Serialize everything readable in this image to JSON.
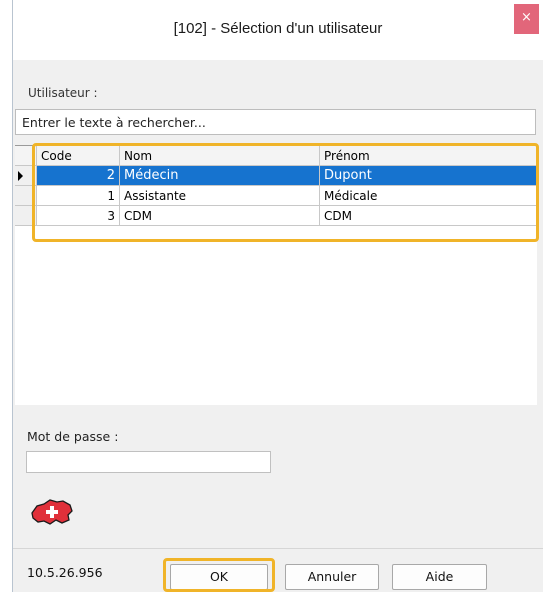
{
  "window": {
    "title": "[102] - Sélection d'un utilisateur",
    "close_label": "×"
  },
  "user_section": {
    "label": "Utilisateur :",
    "search_text": "Entrer le texte à rechercher..."
  },
  "grid": {
    "columns": [
      "Code",
      "Nom",
      "Prénom"
    ],
    "rows": [
      {
        "code": "2",
        "nom": "Médecin",
        "prenom": "Dupont",
        "selected": true
      },
      {
        "code": "1",
        "nom": "Assistante",
        "prenom": "Médicale",
        "selected": false
      },
      {
        "code": "3",
        "nom": "CDM",
        "prenom": "CDM",
        "selected": false
      }
    ]
  },
  "password": {
    "label": "Mot de passe :",
    "value": ""
  },
  "footer": {
    "version": "10.5.26.956",
    "ok_label": "OK",
    "cancel_label": "Annuler",
    "help_label": "Aide"
  },
  "colors": {
    "selection": "#1673cf",
    "highlight": "#f0b429",
    "close": "#e2667a",
    "map_icon": "#e0303a"
  },
  "icons": {
    "map": "switzerland-map-icon",
    "close": "close-icon",
    "row_pointer": "row-pointer-icon"
  }
}
